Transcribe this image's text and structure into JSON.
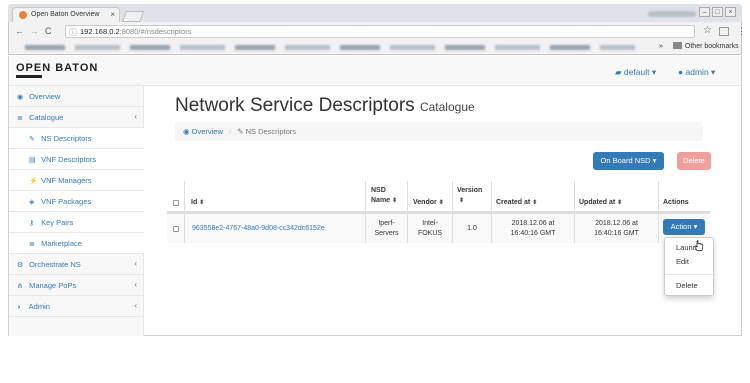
{
  "browser": {
    "tab_title": "Open Baton Overview",
    "url_host": "192.168.0.2",
    "url_path": ":8080/#/nsdescriptors",
    "other_bookmarks": "Other bookmarks",
    "bookmarks_chevron": "»"
  },
  "topnav": {
    "brand": "OPEN BATON",
    "project_label": "default",
    "user_label": "admin"
  },
  "sidebar": {
    "items": [
      {
        "label": "Overview",
        "icon": "dashboard-icon"
      },
      {
        "label": "Catalogue",
        "icon": "database-icon"
      },
      {
        "label": "NS Descriptors",
        "icon": "edit-icon"
      },
      {
        "label": "VNF Descriptors",
        "icon": "file-icon"
      },
      {
        "label": "VNF Managers",
        "icon": "plug-icon"
      },
      {
        "label": "VNF Packages",
        "icon": "cube-icon"
      },
      {
        "label": "Key Pairs",
        "icon": "key-icon"
      },
      {
        "label": "Marketplace",
        "icon": "database-icon"
      },
      {
        "label": "Orchestrate NS",
        "icon": "gears-icon"
      },
      {
        "label": "Manage PoPs",
        "icon": "sitemap-icon"
      },
      {
        "label": "Admin",
        "icon": "shield-icon"
      }
    ]
  },
  "main": {
    "title": "Network Service Descriptors",
    "subtitle": "Catalogue",
    "breadcrumb": {
      "home": "Overview",
      "current": "NS Descriptors",
      "separator": "/"
    },
    "onboard_button": "On Board NSD",
    "delete_button": "Delete"
  },
  "table": {
    "headers": {
      "id": "Id",
      "nsd_name_1": "NSD",
      "nsd_name_2": "Name",
      "vendor": "Vendor",
      "version_1": "Version",
      "created": "Created at",
      "updated": "Updated at",
      "actions": "Actions"
    },
    "rows": [
      {
        "id": "963558e2-4767-48a0-9d08-cc342dc6152e",
        "name_1": "Iperf-",
        "name_2": "Servers",
        "vendor_1": "Intel-",
        "vendor_2": "FOKUS",
        "version": "1.0",
        "created_1": "2018.12.06 at",
        "created_2": "16:40:16 GMT",
        "updated_1": "2018.12.06 at",
        "updated_2": "16:40:16 GMT",
        "action_button": "Action"
      }
    ]
  },
  "action_menu": {
    "items": [
      "Launch",
      "Edit",
      "Delete"
    ]
  },
  "colors": {
    "primary": "#337ab7",
    "danger_disabled": "#f0a09c",
    "sidebar_bg": "#f8f8f8"
  }
}
